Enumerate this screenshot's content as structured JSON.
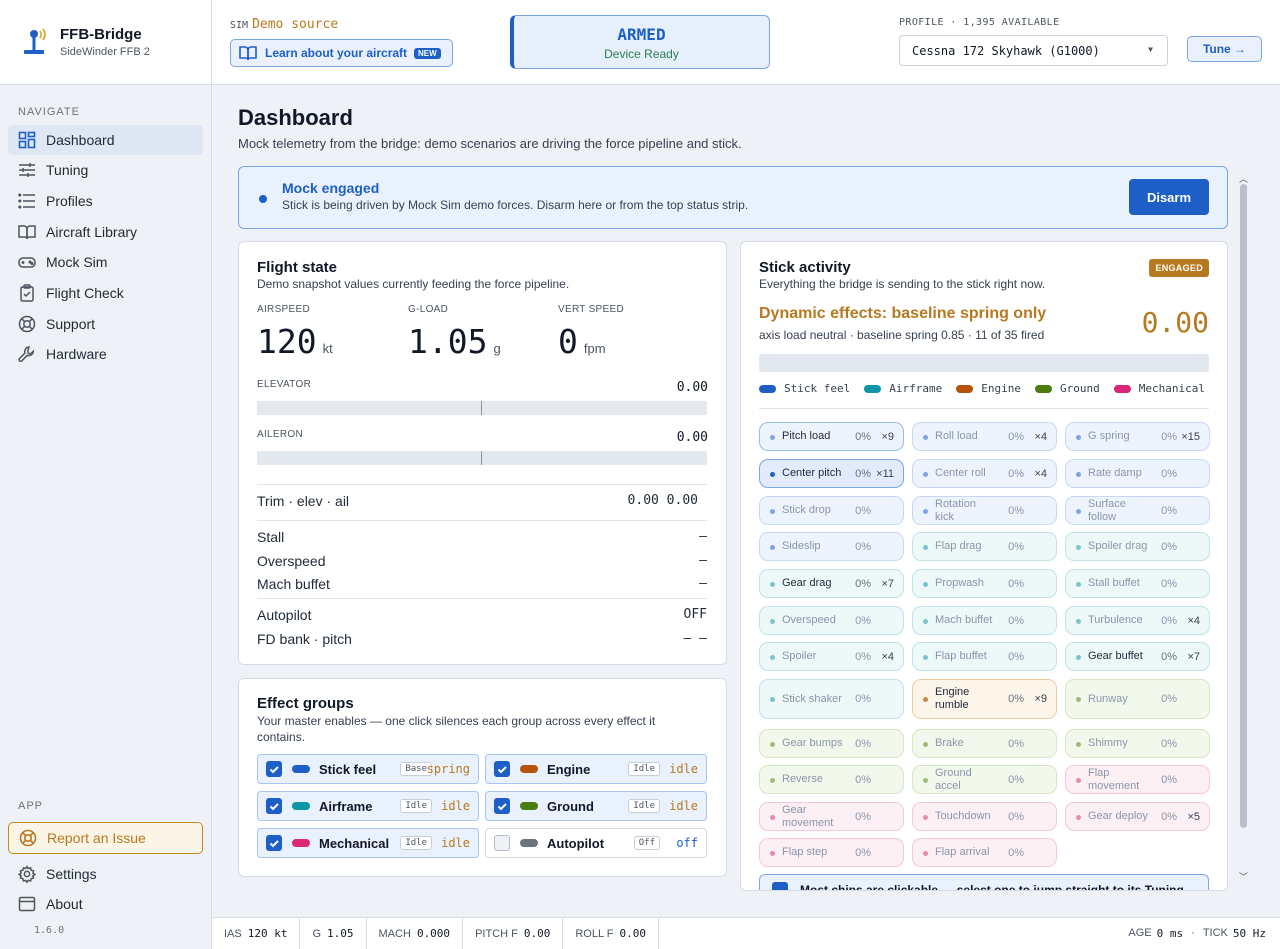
{
  "brand": {
    "title": "FFB-Bridge",
    "subtitle": "SideWinder FFB 2"
  },
  "nav": {
    "heading": "NAVIGATE",
    "items": [
      {
        "label": "Dashboard",
        "icon": "grid-icon",
        "active": true
      },
      {
        "label": "Tuning",
        "icon": "sliders-icon"
      },
      {
        "label": "Profiles",
        "icon": "list-icon"
      },
      {
        "label": "Aircraft Library",
        "icon": "book-icon"
      },
      {
        "label": "Mock Sim",
        "icon": "gamepad-icon"
      },
      {
        "label": "Flight Check",
        "icon": "clipboard-check-icon"
      },
      {
        "label": "Support",
        "icon": "lifebuoy-icon"
      },
      {
        "label": "Hardware",
        "icon": "wrench-icon"
      }
    ],
    "app_heading": "APP",
    "report": "Report an Issue",
    "settings": "Settings",
    "about": "About",
    "version": "1.6.0"
  },
  "header": {
    "sim_label": "SIM",
    "sim_value": "Demo source",
    "learn": "Learn about your aircraft",
    "new_badge": "NEW",
    "armed": "ARMED",
    "armed_sub": "Device Ready",
    "profile_heading": "PROFILE · 1,395 AVAILABLE",
    "profile_value": "Cessna 172 Skyhawk (G1000)",
    "tune": "Tune →"
  },
  "page": {
    "title": "Dashboard",
    "subtitle": "Mock telemetry from the bridge: demo scenarios are driving the force pipeline and stick."
  },
  "mock": {
    "title": "Mock engaged",
    "text": "Stick is being driven by Mock Sim demo forces. Disarm here or from the top status strip.",
    "button": "Disarm"
  },
  "flight": {
    "title": "Flight state",
    "subtitle": "Demo snapshot values currently feeding the force pipeline.",
    "airspeed_label": "AIRSPEED",
    "airspeed": "120",
    "airspeed_unit": "kt",
    "gload_label": "G-LOAD",
    "gload": "1.05",
    "gload_unit": "g",
    "vs_label": "VERT SPEED",
    "vs": "0",
    "vs_unit": "fpm",
    "elevator_label": "ELEVATOR",
    "elevator": "0.00",
    "aileron_label": "AILERON",
    "aileron": "0.00",
    "trim_label": "Trim · elev · ail",
    "trim": "0.00 0.00",
    "stall_label": "Stall",
    "stall": "–",
    "overspeed_label": "Overspeed",
    "overspeed": "–",
    "mach_label": "Mach buffet",
    "mach": "–",
    "autopilot_label": "Autopilot",
    "autopilot": "OFF",
    "fd_label": "FD bank · pitch",
    "fd": "– –"
  },
  "groups": {
    "title": "Effect groups",
    "subtitle": "Your master enables — one click silences each group across every effect it contains.",
    "items": [
      {
        "label": "Stick feel",
        "tag": "Base",
        "state": "spring",
        "color": "#1d5fc7",
        "on": true
      },
      {
        "label": "Engine",
        "tag": "Idle",
        "state": "idle",
        "color": "#b45309",
        "on": true
      },
      {
        "label": "Airframe",
        "tag": "Idle",
        "state": "idle",
        "color": "#0e95a8",
        "on": true
      },
      {
        "label": "Ground",
        "tag": "Idle",
        "state": "idle",
        "color": "#4d7c0f",
        "on": true
      },
      {
        "label": "Mechanical",
        "tag": "Idle",
        "state": "idle",
        "color": "#db2777",
        "on": true
      },
      {
        "label": "Autopilot",
        "tag": "Off",
        "state": "off",
        "color": "#6b7280",
        "on": false
      }
    ]
  },
  "stick": {
    "title": "Stick activity",
    "subtitle": "Everything the bridge is sending to the stick right now.",
    "badge": "ENGAGED",
    "dynamic": "Dynamic effects: baseline spring only",
    "dynamic_sub": "axis load neutral · baseline spring 0.85 · 11 of 35 fired",
    "value": "0.00",
    "legend": [
      {
        "label": "Stick feel",
        "color": "#1d5fc7"
      },
      {
        "label": "Airframe",
        "color": "#0e95a8"
      },
      {
        "label": "Engine",
        "color": "#b45309"
      },
      {
        "label": "Ground",
        "color": "#4d7c0f"
      },
      {
        "label": "Mechanical",
        "color": "#db2777"
      }
    ],
    "chips": [
      {
        "label": "Pitch load",
        "pct": "0%",
        "mult": "×9",
        "group": "feel",
        "active": true
      },
      {
        "label": "Roll load",
        "pct": "0%",
        "mult": "×4",
        "group": "feel"
      },
      {
        "label": "G spring",
        "pct": "0%",
        "mult": "×15",
        "group": "feel"
      },
      {
        "label": "Center pitch",
        "pct": "0%",
        "mult": "×11",
        "group": "feel",
        "active": true,
        "hot": true
      },
      {
        "label": "Center roll",
        "pct": "0%",
        "mult": "×4",
        "group": "feel"
      },
      {
        "label": "Rate damp",
        "pct": "0%",
        "mult": "",
        "group": "feel"
      },
      {
        "label": "Stick drop",
        "pct": "0%",
        "mult": "",
        "group": "feel"
      },
      {
        "label": "Rotation kick",
        "pct": "0%",
        "mult": "",
        "group": "feel"
      },
      {
        "label": "Surface follow",
        "pct": "0%",
        "mult": "",
        "group": "feel"
      },
      {
        "label": "Sideslip",
        "pct": "0%",
        "mult": "",
        "group": "feel"
      },
      {
        "label": "Flap drag",
        "pct": "0%",
        "mult": "",
        "group": "air"
      },
      {
        "label": "Spoiler drag",
        "pct": "0%",
        "mult": "",
        "group": "air"
      },
      {
        "label": "Gear drag",
        "pct": "0%",
        "mult": "×7",
        "group": "air",
        "active": true
      },
      {
        "label": "Propwash",
        "pct": "0%",
        "mult": "",
        "group": "air"
      },
      {
        "label": "Stall buffet",
        "pct": "0%",
        "mult": "",
        "group": "air"
      },
      {
        "label": "Overspeed",
        "pct": "0%",
        "mult": "",
        "group": "air"
      },
      {
        "label": "Mach buffet",
        "pct": "0%",
        "mult": "",
        "group": "air"
      },
      {
        "label": "Turbulence",
        "pct": "0%",
        "mult": "×4",
        "group": "air"
      },
      {
        "label": "Spoiler",
        "pct": "0%",
        "mult": "×4",
        "group": "air"
      },
      {
        "label": "Flap buffet",
        "pct": "0%",
        "mult": "",
        "group": "air"
      },
      {
        "label": "Gear buffet",
        "pct": "0%",
        "mult": "×7",
        "group": "air",
        "active": true
      },
      {
        "label": "Stick shaker",
        "pct": "0%",
        "mult": "",
        "group": "air"
      },
      {
        "label": "Engine rumble",
        "pct": "0%",
        "mult": "×9",
        "group": "eng",
        "active": true
      },
      {
        "label": "Runway",
        "pct": "0%",
        "mult": "",
        "group": "gnd"
      },
      {
        "label": "Gear bumps",
        "pct": "0%",
        "mult": "",
        "group": "gnd"
      },
      {
        "label": "Brake",
        "pct": "0%",
        "mult": "",
        "group": "gnd"
      },
      {
        "label": "Shimmy",
        "pct": "0%",
        "mult": "",
        "group": "gnd"
      },
      {
        "label": "Reverse",
        "pct": "0%",
        "mult": "",
        "group": "gnd"
      },
      {
        "label": "Ground accel",
        "pct": "0%",
        "mult": "",
        "group": "gnd"
      },
      {
        "label": "Flap movement",
        "pct": "0%",
        "mult": "",
        "group": "mech"
      },
      {
        "label": "Gear movement",
        "pct": "0%",
        "mult": "",
        "group": "mech"
      },
      {
        "label": "Touchdown",
        "pct": "0%",
        "mult": "",
        "group": "mech"
      },
      {
        "label": "Gear deploy",
        "pct": "0%",
        "mult": "×5",
        "group": "mech"
      },
      {
        "label": "Flap step",
        "pct": "0%",
        "mult": "",
        "group": "mech"
      },
      {
        "label": "Flap arrival",
        "pct": "0%",
        "mult": "",
        "group": "mech"
      }
    ],
    "hint": "Most chips are clickable — select one to jump straight to its Tuning control."
  },
  "footer": {
    "ias_label": "IAS",
    "ias": "120 kt",
    "g_label": "G",
    "g": "1.05",
    "mach_label": "MACH",
    "mach": "0.000",
    "pitchf_label": "PITCH F",
    "pitchf": "0.00",
    "rollf_label": "ROLL F",
    "rollf": "0.00",
    "age_label": "AGE",
    "age": "0 ms",
    "tick_label": "TICK",
    "tick": "50 Hz"
  }
}
